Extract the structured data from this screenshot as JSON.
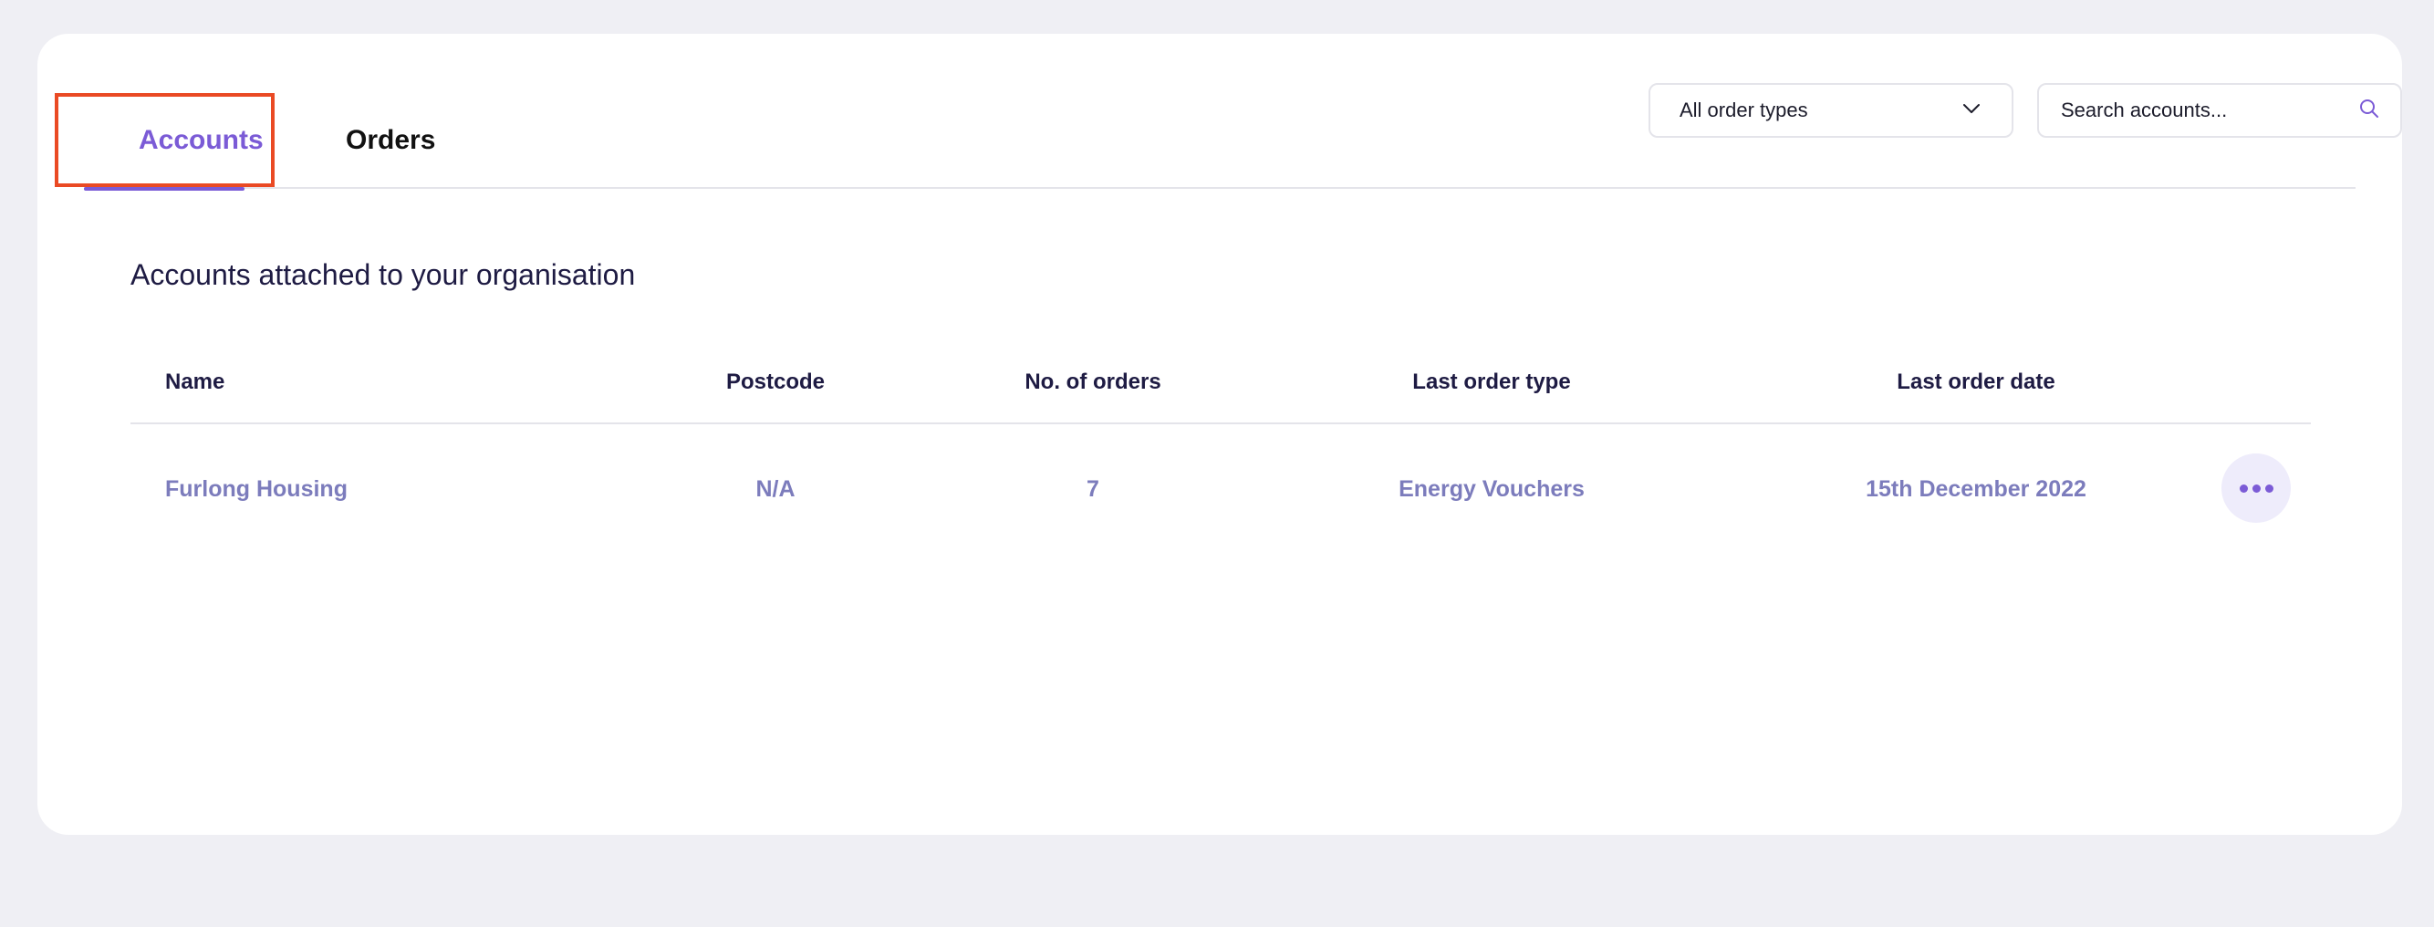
{
  "tabs": [
    {
      "label": "Accounts",
      "active": true
    },
    {
      "label": "Orders",
      "active": false
    }
  ],
  "filter": {
    "selected": "All order types",
    "icon": "chevron-down-icon"
  },
  "search": {
    "placeholder": "Search accounts...",
    "value": "",
    "icon": "search-icon"
  },
  "section_title": "Accounts attached to your organisation",
  "table": {
    "headers": {
      "name": "Name",
      "postcode": "Postcode",
      "orders": "No. of orders",
      "last_type": "Last order type",
      "last_date": "Last order date"
    },
    "rows": [
      {
        "name": "Furlong Housing",
        "postcode": "N/A",
        "orders": "7",
        "last_type": "Energy Vouchers",
        "last_date": "15th December 2022",
        "action_icon": "more-horizontal-icon"
      }
    ]
  },
  "colors": {
    "accent": "#7b5bd6",
    "highlight": "#ea4a24",
    "row_text": "#7c7cbc",
    "heading": "#1e1b43",
    "background": "#efeff4"
  }
}
